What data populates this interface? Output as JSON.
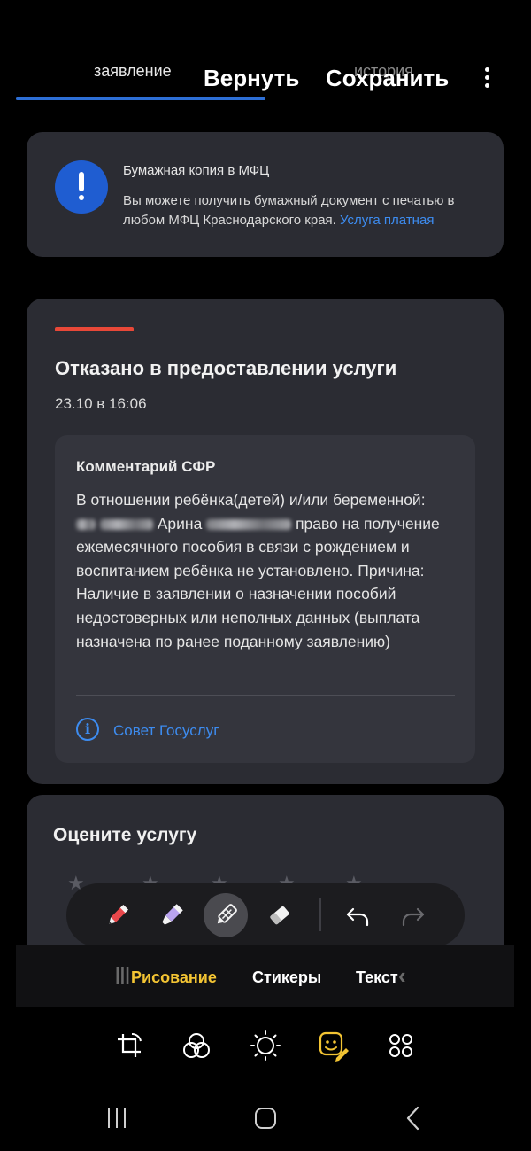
{
  "header": {
    "tab_label": "заявление",
    "tab_label_ghost": "история",
    "revert_label": "Вернуть",
    "save_label": "Сохранить"
  },
  "mfc_card": {
    "title": "Бумажная копия в МФЦ",
    "text": "Вы можете получить бумажный документ с печатью в любом МФЦ Краснодарского края.",
    "link": "Услуга платная"
  },
  "status_card": {
    "title": "Отказано в предоставлении услуги",
    "date": "23.10 в 16:06",
    "comment_title": "Комментарий СФР",
    "comment_line1": "В отношении ребёнка(детей) и/или беременной:",
    "name_fragment": "Арина",
    "comment_rest": "право на получение ежемесячного пособия в связи с рождением и воспитанием ребёнка не установлено. Причина: Наличие в заявлении о назначении пособий недостоверных или неполных данных (выплата назначена по ранее поданному заявлению)",
    "advice_link": "Совет Госуслуг"
  },
  "rating_card": {
    "title": "Оцените услугу",
    "stars": 5
  },
  "toolbar": {
    "tools": [
      "pen-icon",
      "highlighter-icon",
      "mosaic-pen-icon",
      "eraser-icon"
    ],
    "active_tool": "mosaic-pen-icon"
  },
  "modes": {
    "drawing": "Рисование",
    "stickers": "Стикеры",
    "text": "Текст",
    "active": "Рисование"
  },
  "colors": {
    "accent_blue": "#3d8cf0",
    "alert_blue": "#1f5dd1",
    "status_red": "#e84838",
    "active_mode_yellow": "#f3c433"
  }
}
